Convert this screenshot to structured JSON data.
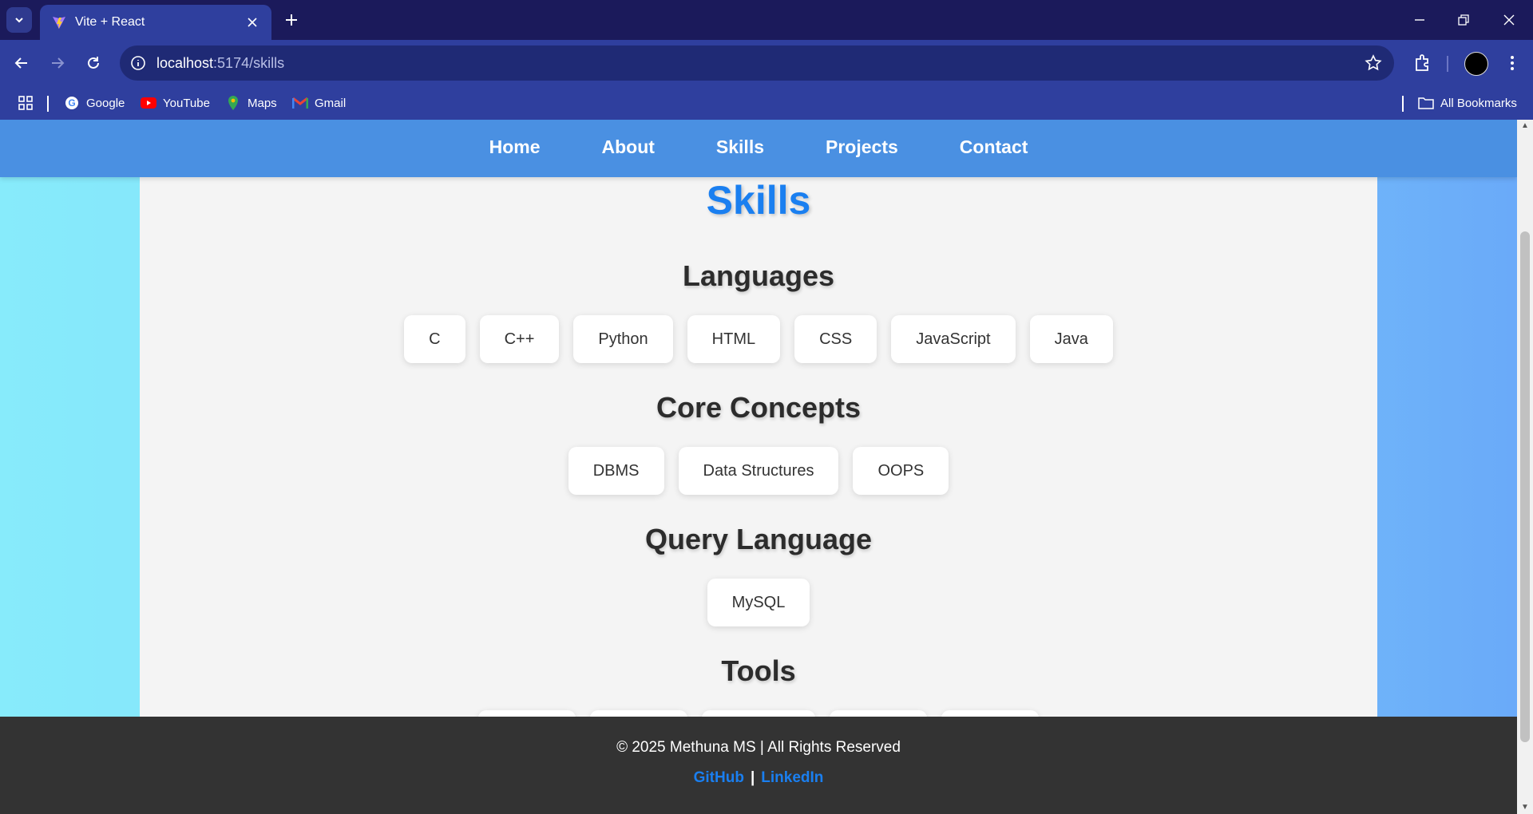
{
  "browser": {
    "tab_title": "Vite + React",
    "url_host": "localhost",
    "url_path": ":5174/skills",
    "bookmarks": [
      {
        "label": "Google",
        "icon": "google-icon"
      },
      {
        "label": "YouTube",
        "icon": "youtube-icon"
      },
      {
        "label": "Maps",
        "icon": "maps-icon"
      },
      {
        "label": "Gmail",
        "icon": "gmail-icon"
      }
    ],
    "all_bookmarks": "All Bookmarks"
  },
  "nav": {
    "items": [
      "Home",
      "About",
      "Skills",
      "Projects",
      "Contact"
    ]
  },
  "page": {
    "title": "Skills",
    "sections": [
      {
        "heading": "Languages",
        "chips": [
          "C",
          "C++",
          "Python",
          "HTML",
          "CSS",
          "JavaScript",
          "Java"
        ]
      },
      {
        "heading": "Core Concepts",
        "chips": [
          "DBMS",
          "Data Structures",
          "OOPS"
        ]
      },
      {
        "heading": "Query Language",
        "chips": [
          "MySQL"
        ]
      },
      {
        "heading": "Tools",
        "chips": []
      }
    ]
  },
  "footer": {
    "copyright": "© 2025 Methuna MS | All Rights Reserved",
    "links": [
      "GitHub",
      "LinkedIn"
    ],
    "separator": "|"
  },
  "colors": {
    "accent": "#1a7ff0",
    "navbar": "#4a90e2",
    "footer": "#333333"
  }
}
